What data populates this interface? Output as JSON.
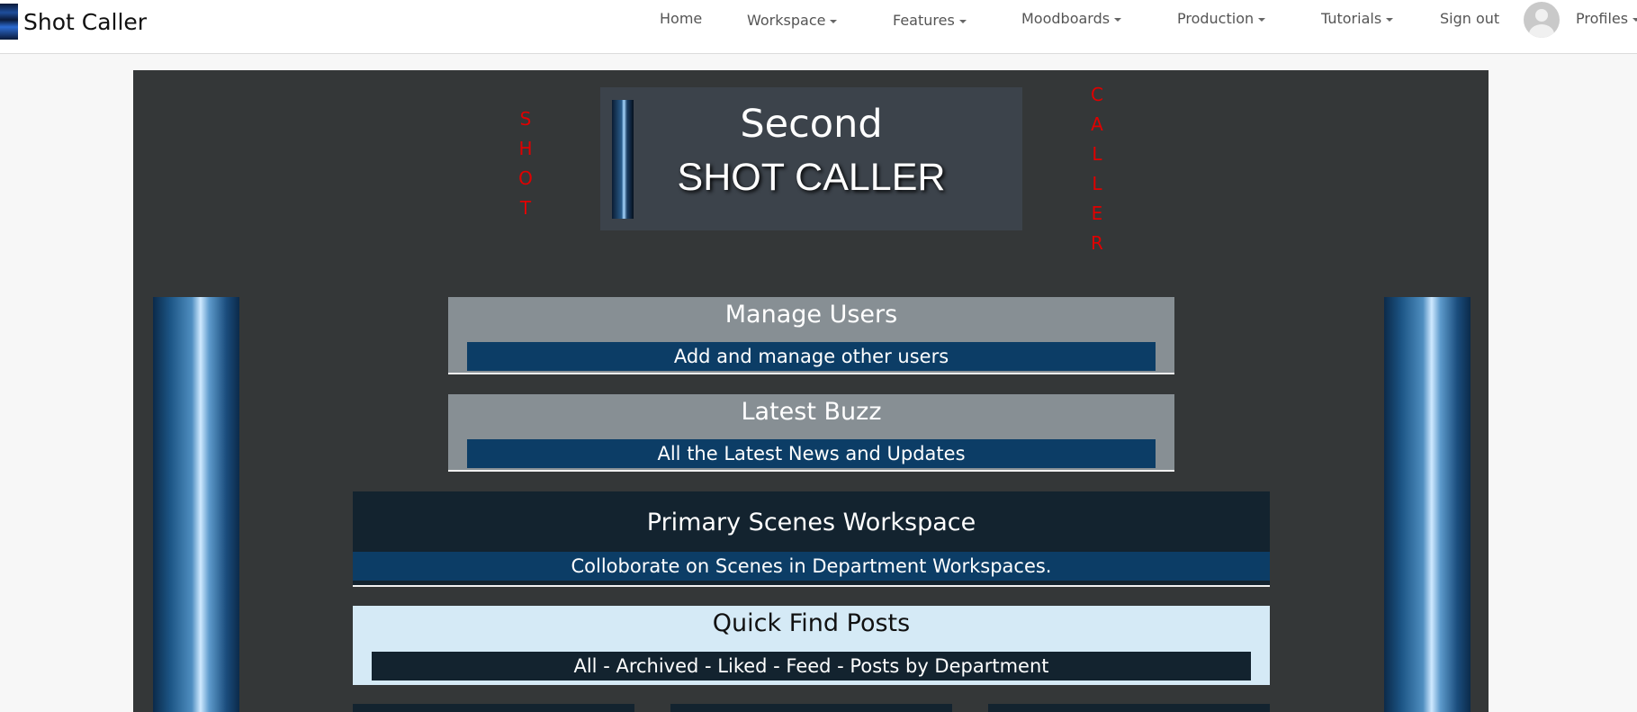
{
  "navbar": {
    "brand": "Shot Caller",
    "items": [
      {
        "label": "Home",
        "dropdown": false
      },
      {
        "label": "Workspace",
        "dropdown": true
      },
      {
        "label": "Features",
        "dropdown": true
      },
      {
        "label": "Moodboards",
        "dropdown": true
      },
      {
        "label": "Production",
        "dropdown": true
      },
      {
        "label": "Tutorials",
        "dropdown": true
      },
      {
        "label": "Sign out",
        "dropdown": false
      },
      {
        "label": "Profiles",
        "dropdown": true
      }
    ],
    "avatar_icon": "user-avatar-icon"
  },
  "header": {
    "left_vertical": "SHOT",
    "right_vertical": "CALLER",
    "title_line1": "Second",
    "title_line2": "SHOT CALLER"
  },
  "cards": [
    {
      "title": "Manage Users",
      "subtitle": "Add and manage other users"
    },
    {
      "title": "Latest Buzz",
      "subtitle": "All the Latest News and Updates"
    },
    {
      "title": "Primary Scenes Workspace",
      "subtitle": "Colloborate on Scenes in Department Workspaces."
    },
    {
      "title": "Quick Find Posts",
      "subtitle": "All - Archived - Liked - Feed - Posts by Department"
    }
  ],
  "colors": {
    "vertical_text": "#e00000",
    "panel_bg": "#343738",
    "card_gray": "#878f94",
    "card_bar_blue": "#0c3d66",
    "card_dark": "#13232f",
    "card_light": "#d5eaf6"
  }
}
